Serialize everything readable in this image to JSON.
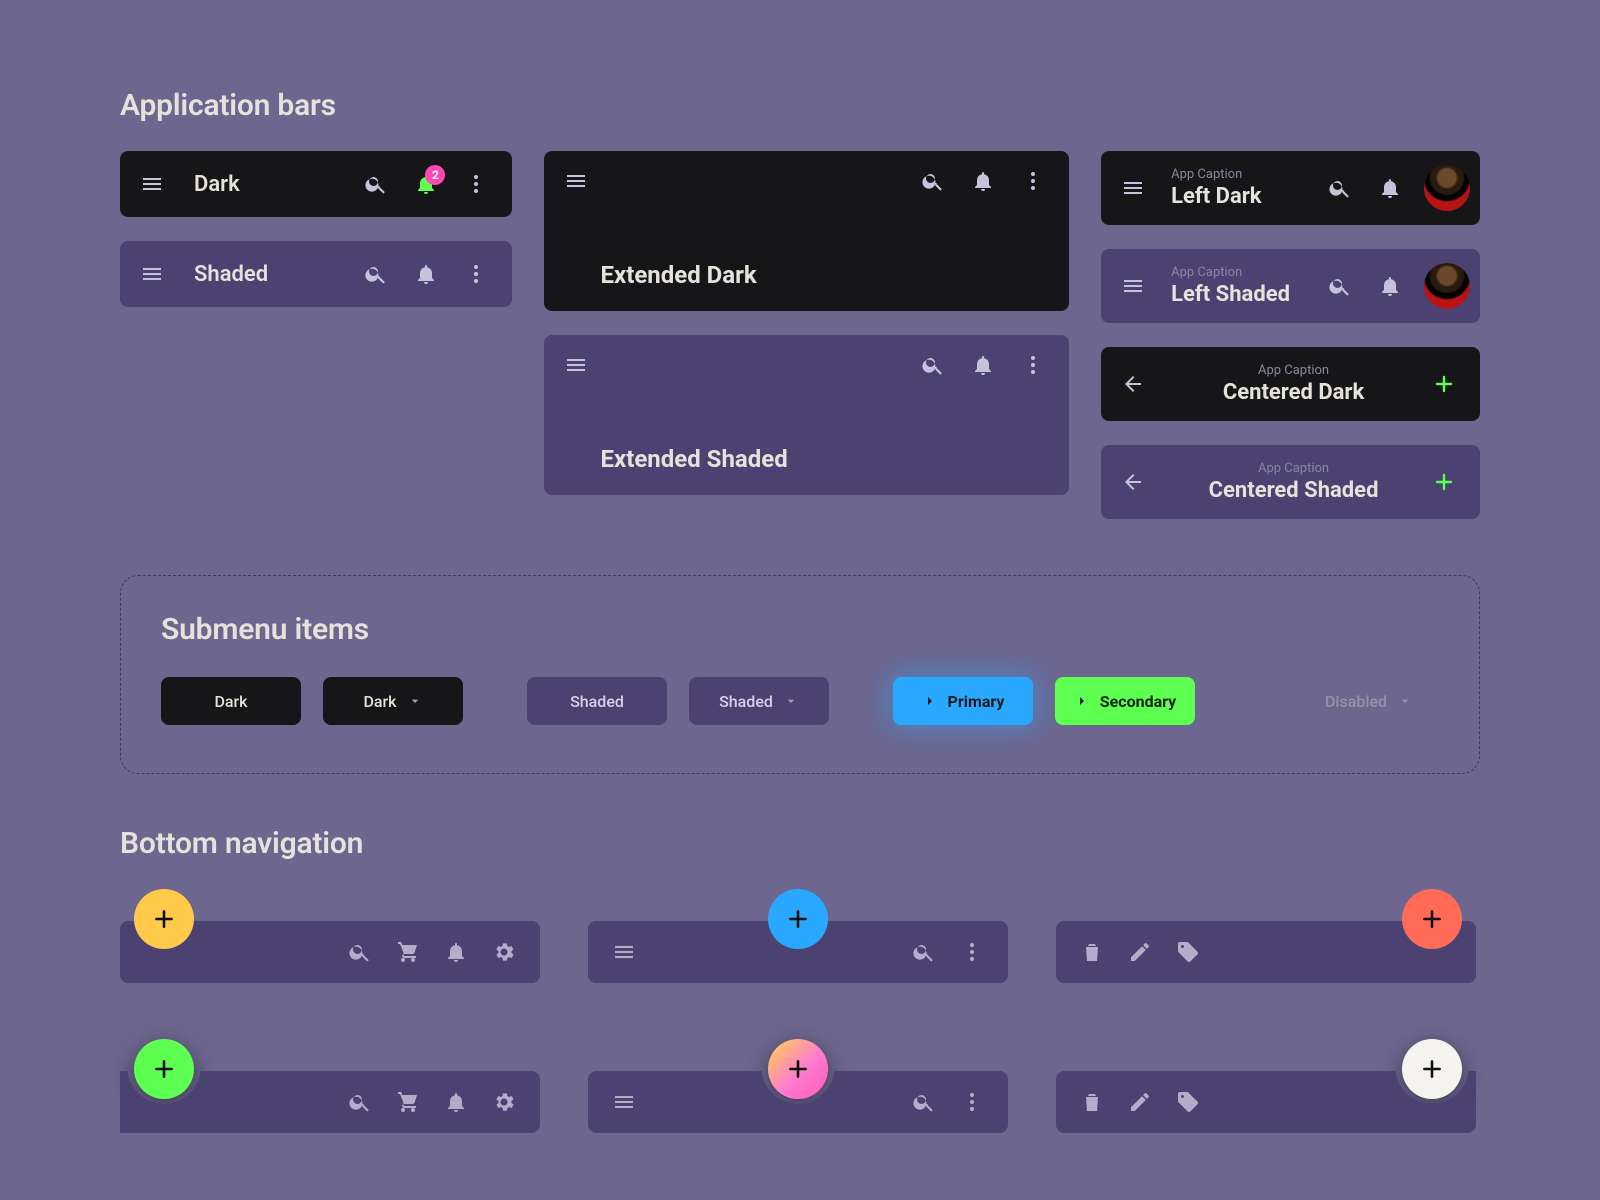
{
  "sections": {
    "appbars": "Application bars",
    "submenu": "Submenu items",
    "bottomnav": "Bottom navigation"
  },
  "badge_count": "2",
  "app_caption": "App Caption",
  "bars": {
    "dark": "Dark",
    "shaded": "Shaded",
    "ext_dark": "Extended Dark",
    "ext_shaded": "Extended Shaded",
    "left_dark": "Left Dark",
    "left_shaded": "Left Shaded",
    "centered_dark": "Centered Dark",
    "centered_shaded": "Centered Shaded"
  },
  "submenu": {
    "dark": "Dark",
    "dark_dd": "Dark",
    "shaded": "Shaded",
    "shaded_dd": "Shaded",
    "primary": "Primary",
    "secondary": "Secondary",
    "disabled": "Disabled"
  },
  "colors": {
    "accent_green": "#5dff50",
    "accent_blue": "#2aa8ff",
    "badge_pink": "#ff46b5",
    "fab_yellow": "#ffc94a",
    "fab_red": "#ff6b57",
    "fab_white": "#f5f3ee"
  }
}
